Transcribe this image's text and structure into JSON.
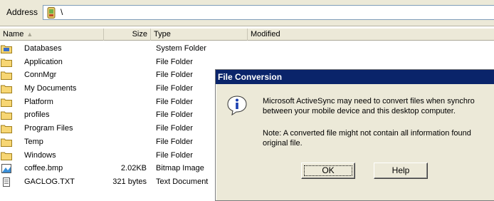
{
  "address": {
    "label": "Address",
    "path": "\\"
  },
  "columns": {
    "name": "Name",
    "size": "Size",
    "type": "Type",
    "modified": "Modified"
  },
  "files": [
    {
      "name": "Databases",
      "size": "",
      "type": "System Folder",
      "icon": "special-folder-icon"
    },
    {
      "name": "Application",
      "size": "",
      "type": "File Folder",
      "icon": "folder-icon"
    },
    {
      "name": "ConnMgr",
      "size": "",
      "type": "File Folder",
      "icon": "folder-icon"
    },
    {
      "name": "My Documents",
      "size": "",
      "type": "File Folder",
      "icon": "folder-icon"
    },
    {
      "name": "Platform",
      "size": "",
      "type": "File Folder",
      "icon": "folder-icon"
    },
    {
      "name": "profiles",
      "size": "",
      "type": "File Folder",
      "icon": "folder-icon"
    },
    {
      "name": "Program Files",
      "size": "",
      "type": "File Folder",
      "icon": "folder-icon"
    },
    {
      "name": "Temp",
      "size": "",
      "type": "File Folder",
      "icon": "folder-icon"
    },
    {
      "name": "Windows",
      "size": "",
      "type": "File Folder",
      "icon": "folder-icon"
    },
    {
      "name": "coffee.bmp",
      "size": "2.02KB",
      "type": "Bitmap Image",
      "icon": "bitmap-icon"
    },
    {
      "name": "GACLOG.TXT",
      "size": "321 bytes",
      "type": "Text Document",
      "icon": "text-file-icon"
    }
  ],
  "dialog": {
    "title": "File Conversion",
    "message": "Microsoft ActiveSync may need to convert files when synchro\nbetween your mobile device and this desktop computer.",
    "note": "Note: A converted file might not contain all information found\noriginal file.",
    "ok_label": "OK",
    "help_label": "Help",
    "icon": "info-icon"
  },
  "colors": {
    "title_bar": "#0a246a",
    "folder": "#f7d674",
    "window_bg": "#ece9d8"
  }
}
